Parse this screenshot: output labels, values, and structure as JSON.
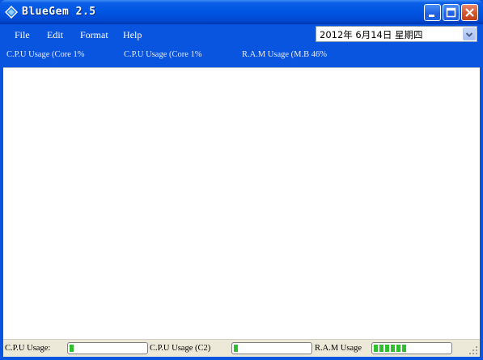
{
  "window": {
    "title": "BlueGem 2.5",
    "accent": "#0a55e0"
  },
  "titlebar_buttons": {
    "minimize": "minimize-icon",
    "maximize": "maximize-icon",
    "close": "close-icon"
  },
  "menu": {
    "items": [
      {
        "label": "File"
      },
      {
        "label": "Edit"
      },
      {
        "label": "Format"
      },
      {
        "label": "Help"
      }
    ]
  },
  "date_picker": {
    "value": "2012年 6月14日 星期四"
  },
  "usage_bar": {
    "cpu_core1": "C.P.U Usage (Core 1%",
    "cpu_core2": "C.P.U Usage (Core 1%",
    "ram": "R.A.M Usage (M.B 46%"
  },
  "status": {
    "cpu_label": "C.P.U Usage:",
    "cpu2_label": "C.P.U Usage (C2)",
    "ram_label": "R.A.M Usage",
    "cpu_level": 0.05,
    "cpu2_level": 0.05,
    "ram_level": 0.46,
    "meter_color": "#2fbf2f"
  }
}
